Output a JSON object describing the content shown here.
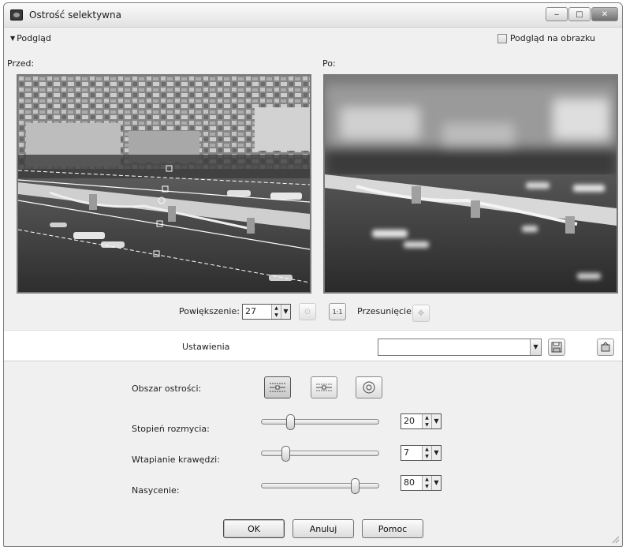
{
  "window": {
    "title": "Ostrość selektywna"
  },
  "title_buttons": {
    "minimize": "‒",
    "maximize": "□",
    "close": "✕"
  },
  "preview": {
    "toggle_label": "Podgląd",
    "on_image_label": "Podgląd na obrazku",
    "on_image_checked": false,
    "before_label": "Przed:",
    "after_label": "Po:"
  },
  "zoom": {
    "label": "Powiększenie:",
    "value": "27",
    "pan_label": "Przesunięcie:",
    "actual_size_icon_text": "1:1"
  },
  "settings": {
    "label": "Ustawienia",
    "preset_value": ""
  },
  "focus": {
    "area_label": "Obszar ostrości:",
    "modes": [
      "rectangle-focus-icon",
      "line-focus-icon",
      "ellipse-focus-icon"
    ],
    "active_mode": 0
  },
  "sliders": [
    {
      "label": "Stopień rozmycia:",
      "value": "20",
      "fraction": 0.24
    },
    {
      "label": "Wtapianie krawędzi:",
      "value": "7",
      "fraction": 0.2
    },
    {
      "label": "Nasycenie:",
      "value": "80",
      "fraction": 0.8
    }
  ],
  "buttons": {
    "ok": "OK",
    "cancel": "Anuluj",
    "help": "Pomoc"
  }
}
